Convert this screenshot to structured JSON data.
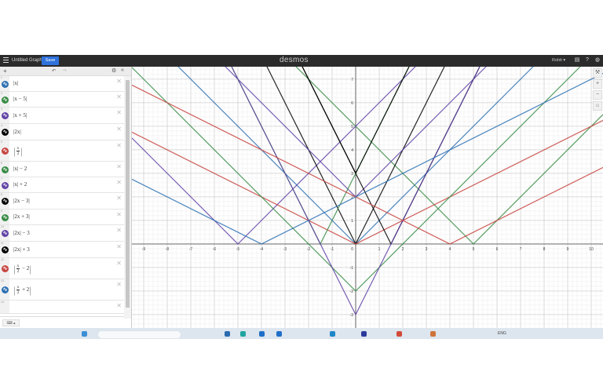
{
  "topbar": {
    "title": "Untitled Graph",
    "save_label": "Save",
    "logo": "desmos",
    "user": "Rohit ▾"
  },
  "colors": {
    "red": "#c74440",
    "blue": "#2d70b3",
    "green": "#388c46",
    "purple": "#6042a6",
    "black": "#000000"
  },
  "expressions": [
    {
      "index": "1",
      "color": "blue",
      "parts": {
        "pre": "|x|"
      },
      "fn": {
        "a": 1,
        "b": 0,
        "c": 0
      }
    },
    {
      "index": "2",
      "color": "green",
      "parts": {
        "pre": "|x − 5|"
      },
      "fn": {
        "a": 1,
        "b": -5,
        "c": 0
      }
    },
    {
      "index": "3",
      "color": "purple",
      "parts": {
        "pre": "|x + 5|"
      },
      "fn": {
        "a": 1,
        "b": 5,
        "c": 0
      }
    },
    {
      "index": "4",
      "color": "black",
      "parts": {
        "pre": "|2x|"
      },
      "fn": {
        "a": 2,
        "b": 0,
        "c": 0
      }
    },
    {
      "index": "5",
      "color": "red",
      "parts": {
        "num": "x",
        "den": "2",
        "post": ""
      },
      "fn": {
        "a": 0.5,
        "b": 0,
        "c": 0
      }
    },
    {
      "index": "6",
      "color": "green",
      "parts": {
        "pre": "|x| − 2"
      },
      "fn": {
        "a": 1,
        "b": 0,
        "c": -2
      }
    },
    {
      "index": "7",
      "color": "purple",
      "parts": {
        "pre": "|x| + 2"
      },
      "fn": {
        "a": 1,
        "b": 0,
        "c": 2
      }
    },
    {
      "index": "8",
      "color": "black",
      "parts": {
        "pre": "|2x − 3|"
      },
      "fn": {
        "a": 2,
        "b": -3,
        "c": 0
      }
    },
    {
      "index": "9",
      "color": "green",
      "parts": {
        "pre": "|2x + 3|"
      },
      "fn": {
        "a": 2,
        "b": 3,
        "c": 0
      }
    },
    {
      "index": "10",
      "color": "purple",
      "parts": {
        "pre": "|2x| − 3"
      },
      "fn": {
        "a": 2,
        "b": 0,
        "c": -3
      }
    },
    {
      "index": "11",
      "color": "black",
      "parts": {
        "pre": "|2x| + 3"
      },
      "fn": {
        "a": 2,
        "b": 0,
        "c": 3
      }
    },
    {
      "index": "12",
      "color": "red",
      "parts": {
        "num": "x",
        "den": "2",
        "post": " − 2"
      },
      "fn": {
        "a": 0.5,
        "b": -2,
        "c": 0
      }
    },
    {
      "index": "13",
      "color": "blue",
      "parts": {
        "num": "x",
        "den": "2",
        "post": " + 2"
      },
      "fn": {
        "a": 0.5,
        "b": 2,
        "c": 0
      }
    },
    {
      "index": "14",
      "color": "",
      "parts": {},
      "fn": null
    }
  ],
  "graph": {
    "xmin": -9.5,
    "xmax": 10.5,
    "ymin": -3.57,
    "ymax": 7.53,
    "x_ticks": [
      -9,
      -8,
      -7,
      -6,
      -5,
      -4,
      -3,
      -2,
      -1,
      1,
      2,
      3,
      4,
      5,
      6,
      7,
      8,
      9,
      10
    ],
    "y_ticks": [
      -3,
      -2,
      -1,
      1,
      2,
      3,
      4,
      5,
      6,
      7
    ],
    "origin_label": "0"
  },
  "taskbar": {
    "lang": "ENG"
  }
}
